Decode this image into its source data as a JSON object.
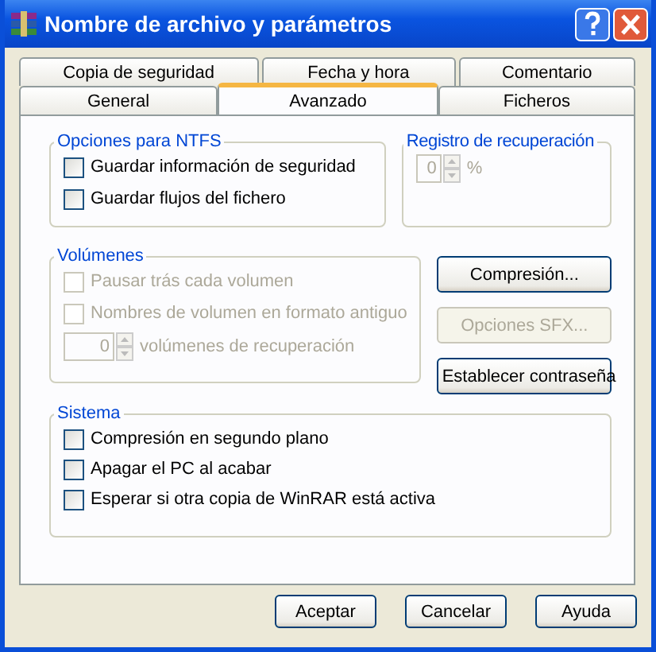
{
  "window": {
    "title": "Nombre de archivo y parámetros"
  },
  "tab_rows": [
    [
      {
        "label": "Copia de seguridad",
        "selected": false
      },
      {
        "label": "Fecha y hora",
        "selected": false
      },
      {
        "label": "Comentario",
        "selected": false
      }
    ],
    [
      {
        "label": "General",
        "selected": false
      },
      {
        "label": "Avanzado",
        "selected": true
      },
      {
        "label": "Ficheros",
        "selected": false
      }
    ]
  ],
  "ntfs": {
    "title": "Opciones para NTFS",
    "options": [
      {
        "label": "Guardar información de seguridad",
        "checked": false,
        "disabled": false
      },
      {
        "label": "Guardar flujos del fichero",
        "checked": false,
        "disabled": false
      }
    ]
  },
  "recovery_record": {
    "title": "Registro de recuperación",
    "value": "0",
    "unit": "%",
    "disabled": true
  },
  "volumes": {
    "title": "Volúmenes",
    "options": [
      {
        "label": "Pausar trás cada volumen",
        "checked": false,
        "disabled": true
      },
      {
        "label": "Nombres de volumen en formato antiguo",
        "checked": false,
        "disabled": true
      }
    ],
    "spinner": {
      "value": "0",
      "label": "volúmenes de recuperación",
      "disabled": true
    }
  },
  "side_buttons": [
    {
      "label": "Compresión...",
      "disabled": false
    },
    {
      "label": "Opciones SFX...",
      "disabled": true
    },
    {
      "label": "Establecer contraseña",
      "disabled": false
    }
  ],
  "system": {
    "title": "Sistema",
    "options": [
      {
        "label": "Compresión en segundo plano",
        "checked": false,
        "disabled": false
      },
      {
        "label": "Apagar el PC al acabar",
        "checked": false,
        "disabled": false
      },
      {
        "label": "Esperar si otra copia de WinRAR está activa",
        "checked": false,
        "disabled": false
      }
    ]
  },
  "footer_buttons": [
    "Aceptar",
    "Cancelar",
    "Ayuda"
  ]
}
